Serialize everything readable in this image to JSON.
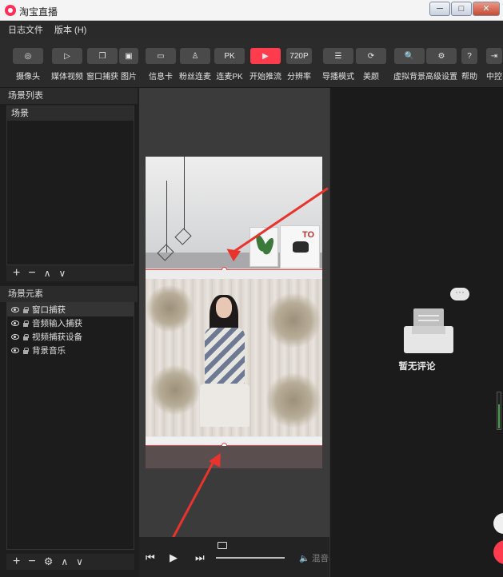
{
  "window": {
    "title": "淘宝直播",
    "controls": [
      "─",
      "□",
      "✕"
    ]
  },
  "menu": {
    "items": [
      "日志文件",
      "版本 (H)"
    ]
  },
  "toolbar": {
    "items": [
      {
        "label": "摄像头",
        "icon": "camera-icon",
        "glyph": "◎"
      },
      {
        "label": "媒体视频",
        "icon": "play-icon",
        "glyph": "▷"
      },
      {
        "label": "窗口捕获",
        "icon": "window-copy-icon",
        "glyph": "❐"
      },
      {
        "label": "图片",
        "icon": "image-icon",
        "glyph": "▣"
      },
      {
        "label": "信息卡",
        "icon": "card-icon",
        "glyph": "▭"
      },
      {
        "label": "粉丝连麦",
        "icon": "user-icon",
        "glyph": "♙"
      },
      {
        "label": "连麦PK",
        "icon": "pk-icon",
        "glyph": "PK"
      },
      {
        "label": "开始推流",
        "icon": "start-stream-icon",
        "glyph": "▶"
      },
      {
        "label": "分辨率",
        "icon": "resolution-icon",
        "glyph": "720P"
      },
      {
        "label": "导播模式",
        "icon": "director-mode-icon",
        "glyph": "☰"
      },
      {
        "label": "美颜",
        "icon": "beauty-icon",
        "glyph": "⟳"
      },
      {
        "label": "虚拟背景",
        "icon": "virtual-bg-icon",
        "glyph": "🔍"
      },
      {
        "label": "高级设置",
        "icon": "settings-icon",
        "glyph": "⚙"
      },
      {
        "label": "帮助",
        "icon": "help-icon",
        "glyph": "?"
      },
      {
        "label": "中控",
        "icon": "control-icon",
        "glyph": "⇥"
      }
    ]
  },
  "scenes": {
    "title": "场景列表",
    "header": "场景"
  },
  "elements": {
    "title": "场景元素",
    "items": [
      "窗口捕获",
      "音频输入捕获",
      "视频捕获设备",
      "背景音乐"
    ]
  },
  "poster": {
    "text": "TO"
  },
  "comments": {
    "empty_text": "暂无评论",
    "bubble": "···"
  },
  "player": {
    "mix_label": "混音器",
    "progress": 0.0
  },
  "colors": {
    "accent": "#ff3b4e",
    "arrow": "#e8342d"
  }
}
